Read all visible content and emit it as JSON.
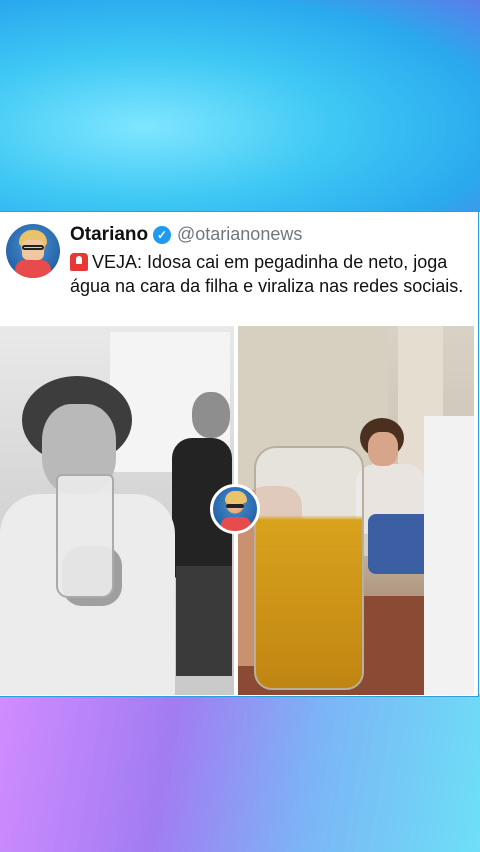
{
  "post": {
    "display_name": "Otariano",
    "handle": "@otarianonews",
    "text_prefix": "VEJA:",
    "text_body": "Idosa cai em pegadinha de neto, joga água na cara da filha e viraliza nas redes sociais.",
    "verified": true
  },
  "icons": {
    "verified": "verified-check-icon",
    "alert": "siren-emoji-icon"
  },
  "colors": {
    "verified_blue": "#1d9bf0",
    "card_border": "#2f9fd8",
    "text": "#111111",
    "handle": "#6e7781"
  }
}
